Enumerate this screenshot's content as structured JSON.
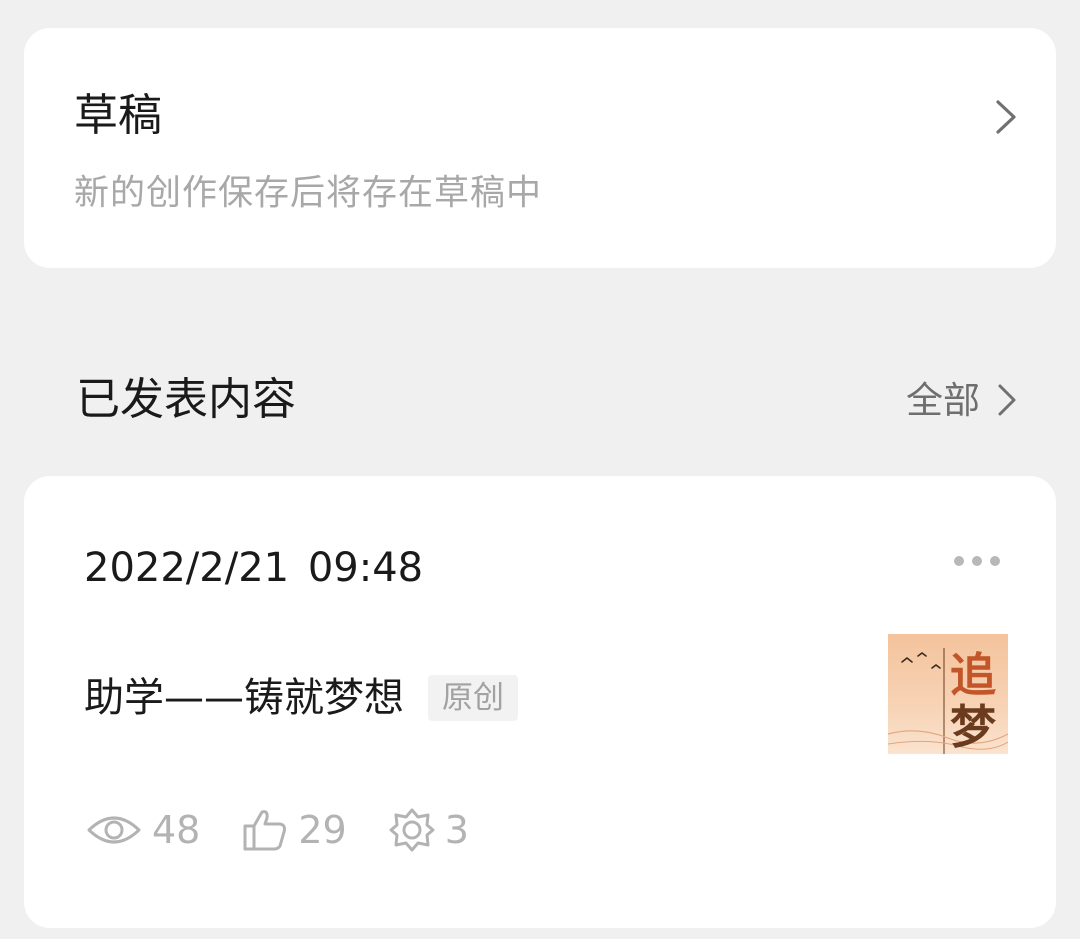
{
  "drafts": {
    "title": "草稿",
    "subtitle": "新的创作保存后将存在草稿中",
    "chevron_icon": "chevron-right-icon"
  },
  "published": {
    "title": "已发表内容",
    "all_label": "全部",
    "chevron_icon": "chevron-right-icon"
  },
  "post": {
    "date": "2022/2/21  09:48",
    "more_icon": "more-horizontal-icon",
    "title": "助学——铸就梦想",
    "badge": "原创",
    "thumbnail_text": [
      "追",
      "梦"
    ],
    "stats": {
      "views": "48",
      "likes": "29",
      "shares": "3"
    },
    "stat_icons": [
      "eye-icon",
      "thumbs-up-icon",
      "badge-icon"
    ]
  },
  "colors": {
    "background": "#f0f0f0",
    "card": "#ffffff",
    "primary_text": "#1a1a1a",
    "secondary_text": "#a8a8a8",
    "muted_text": "#b3b3b3"
  }
}
